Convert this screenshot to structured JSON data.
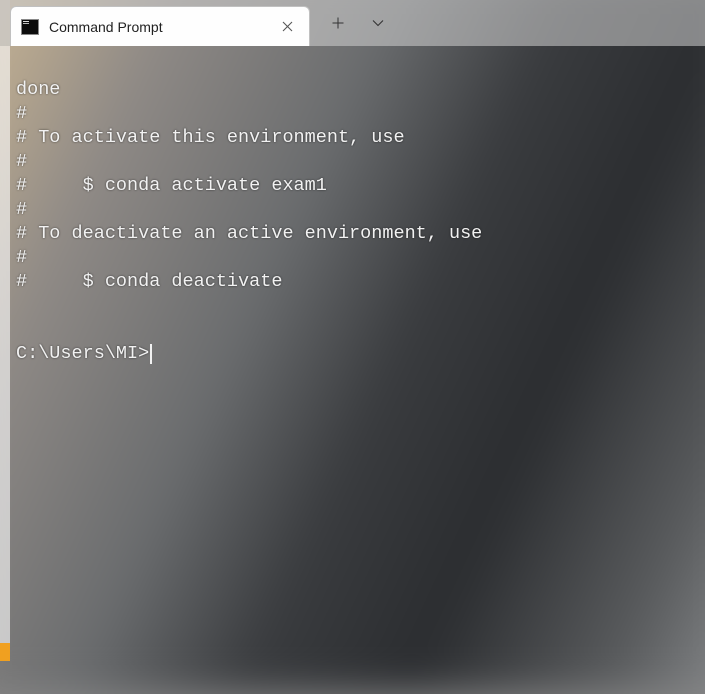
{
  "tab": {
    "title": "Command Prompt"
  },
  "terminal": {
    "lines": [
      "done",
      "#",
      "# To activate this environment, use",
      "#",
      "#     $ conda activate exam1",
      "#",
      "# To deactivate an active environment, use",
      "#",
      "#     $ conda deactivate",
      "",
      ""
    ],
    "prompt": "C:\\Users\\MI>"
  }
}
